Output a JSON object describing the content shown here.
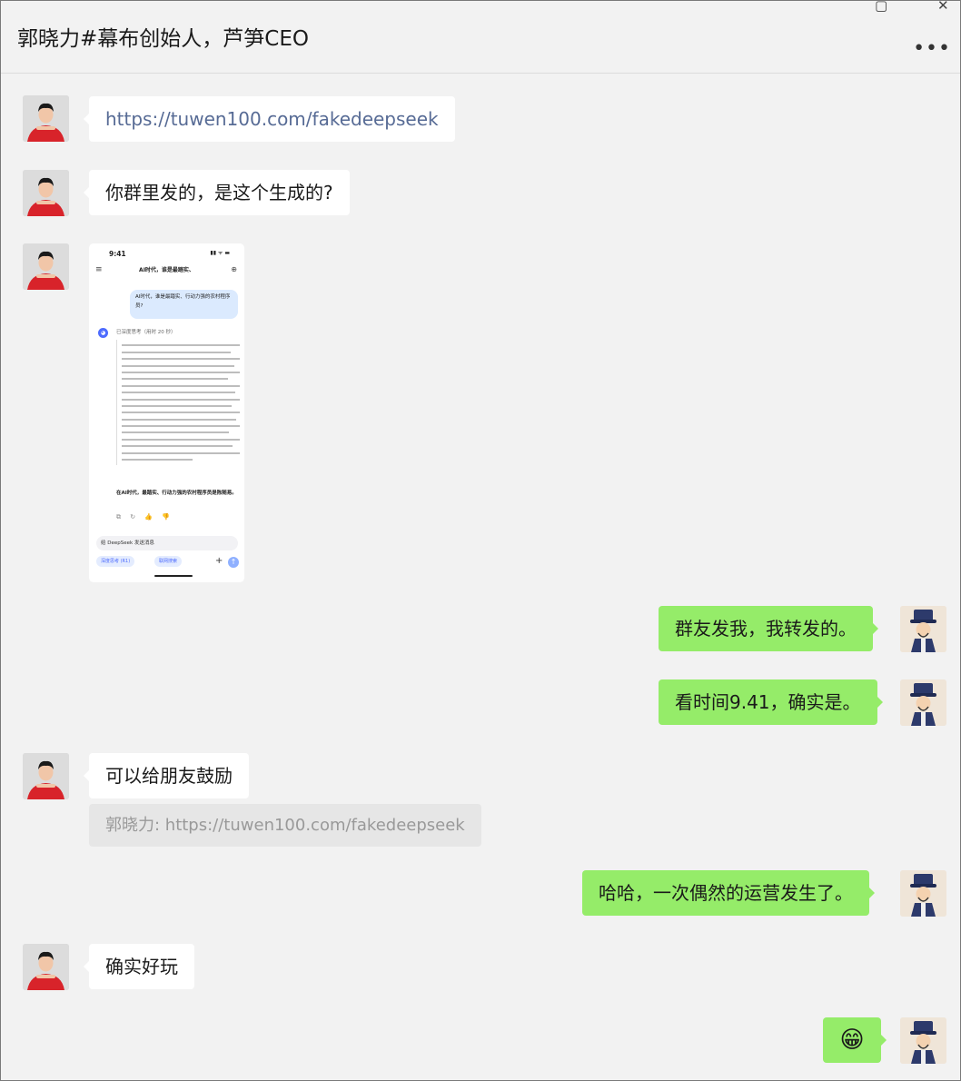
{
  "window": {
    "title": "郭晓力#幕布创始人，芦笋CEO",
    "minimize_glyph": "▢",
    "close_glyph": "✕",
    "more_glyph": "•••"
  },
  "messages": [
    {
      "side": "left",
      "text": "https://tuwen100.com/fakedeepseek",
      "is_link": true
    },
    {
      "side": "left",
      "text": "你群里发的，是这个生成的?"
    },
    {
      "side": "left",
      "type": "image"
    },
    {
      "side": "right",
      "text": "群友发我，我转发的。"
    },
    {
      "side": "right",
      "text": "看时间9.41，确实是。"
    },
    {
      "side": "left",
      "text": "可以给朋友鼓励",
      "quote": "郭晓力: https://tuwen100.com/fakedeepseek"
    },
    {
      "side": "right",
      "text": "哈哈，一次偶然的运营发生了。"
    },
    {
      "side": "left",
      "text": "确实好玩"
    },
    {
      "side": "right",
      "text": "😁"
    }
  ],
  "screenshot": {
    "time": "9:41",
    "signal": "▮▮ ᯤ ▬",
    "header_title": "AI时代，谁是最踏实、",
    "user_question": "AI时代，谁是最踏实、行动力强的农村程序员?",
    "logo_glyph": "◕",
    "thinking_label": "已深度思考（用时 20 秒）",
    "answer": "在AI时代，最踏实、行动力强的农村程序员是陈随易。",
    "action_icons": "⧉ ↻ 👍 👎",
    "input_placeholder": "给 DeepSeek 发送消息",
    "chip_deep_think": "深度思考 (R1)",
    "chip_web_search": "联网搜索",
    "plus_glyph": "+",
    "send_glyph": "↑",
    "menu_glyph": "≡",
    "new_chat_glyph": "⊕"
  },
  "colors": {
    "background": "#f2f2f2",
    "bubble_left": "#ffffff",
    "bubble_right": "#95ec69",
    "link": "#576b95",
    "quote_bg": "#e6e6e6",
    "quote_text": "#999999"
  },
  "icons": {
    "left_avatar": "man-red-shirt-avatar",
    "right_avatar": "cartoon-official-hat-avatar"
  }
}
